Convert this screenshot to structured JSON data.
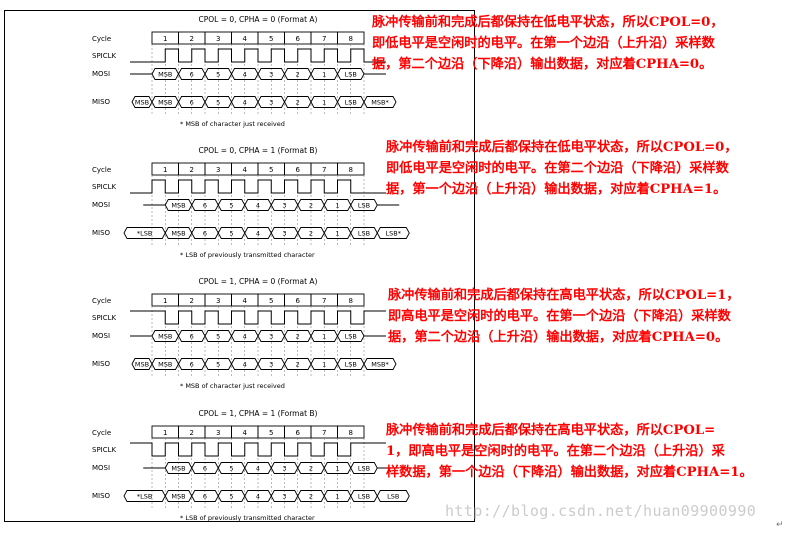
{
  "sections": [
    {
      "title": "CPOL = 0, CPHA = 0 (Format A)",
      "cpol": 0,
      "cpha": 0,
      "labels": {
        "cycle": "Cycle",
        "sclk": "SPICLK",
        "mosi": "MOSI",
        "miso": "MISO"
      },
      "cycles": [
        "1",
        "2",
        "3",
        "4",
        "5",
        "6",
        "7",
        "8"
      ],
      "mosi": [
        "MSB",
        "6",
        "5",
        "4",
        "3",
        "2",
        "1",
        "LSB"
      ],
      "miso_pre": "MSB",
      "miso": [
        "MSB",
        "6",
        "5",
        "4",
        "3",
        "2",
        "1",
        "LSB"
      ],
      "miso_post": "MSB*",
      "footnote": "* MSB of character just received",
      "note_lines": [
        "脉冲传输前和完成后都保持在低电平状态，所以CPOL=0，",
        "即低电平是空闲时的电平。在第一个边沿（上升沿）采样数",
        "据，第二个边沿（下降沿）输出数据，对应着CPHA=0。"
      ]
    },
    {
      "title": "CPOL = 0, CPHA = 1 (Format B)",
      "cpol": 0,
      "cpha": 1,
      "labels": {
        "cycle": "Cycle",
        "sclk": "SPICLK",
        "mosi": "MOSI",
        "miso": "MISO"
      },
      "cycles": [
        "1",
        "2",
        "3",
        "4",
        "5",
        "6",
        "7",
        "8"
      ],
      "mosi": [
        "MSB",
        "6",
        "5",
        "4",
        "3",
        "2",
        "1",
        "LSB"
      ],
      "miso_pre": "*LSB",
      "miso": [
        "MSB",
        "6",
        "5",
        "4",
        "3",
        "2",
        "1",
        "LSB"
      ],
      "miso_post": "LSB*",
      "footnote": "* LSB of previously transmitted character",
      "note_lines": [
        "脉冲传输前和完成后都保持在低电平状态，所以CPOL=0，",
        "即低电平是空闲时的电平。在第二个边沿（下降沿）采样数",
        "据，第一个边沿（上升沿）输出数据，对应着CPHA=1。"
      ]
    },
    {
      "title": "CPOL = 1, CPHA = 0 (Format A)",
      "cpol": 1,
      "cpha": 0,
      "labels": {
        "cycle": "Cycle",
        "sclk": "SPICLK",
        "mosi": "MOSI",
        "miso": "MISO"
      },
      "cycles": [
        "1",
        "2",
        "3",
        "4",
        "5",
        "6",
        "7",
        "8"
      ],
      "mosi": [
        "MSB",
        "6",
        "5",
        "4",
        "3",
        "2",
        "1",
        "LSB"
      ],
      "miso_pre": "MSB",
      "miso": [
        "MSB",
        "6",
        "5",
        "4",
        "3",
        "2",
        "1",
        "LSB"
      ],
      "miso_post": "MSB*",
      "footnote": "* MSB of character just received",
      "note_lines": [
        "脉冲传输前和完成后都保持在高电平状态，所以CPOL=1，",
        "即高电平是空闲时的电平。在第一个边沿（下降沿）采样数",
        "据，第二个边沿（上升沿）输出数据，对应着CPHA=0。"
      ]
    },
    {
      "title": "CPOL = 1, CPHA = 1 (Format B)",
      "cpol": 1,
      "cpha": 1,
      "labels": {
        "cycle": "Cycle",
        "sclk": "SPICLK",
        "mosi": "MOSI",
        "miso": "MISO"
      },
      "cycles": [
        "1",
        "2",
        "3",
        "4",
        "5",
        "6",
        "7",
        "8"
      ],
      "mosi": [
        "MSB",
        "6",
        "5",
        "4",
        "3",
        "2",
        "1",
        "LSB"
      ],
      "miso_pre": "*LSB",
      "miso": [
        "MSB",
        "6",
        "5",
        "4",
        "3",
        "2",
        "1",
        "LSB"
      ],
      "miso_post": "LSB",
      "footnote": "* LSB of previously transmitted character",
      "note_lines": [
        "脉冲传输前和完成后都保持在高电平状态，所以CPOL=",
        "1，即高电平是空闲时的电平。在第二个边沿（上升沿）采",
        "样数据，第一个边沿（下降沿）输出数据，对应着CPHA=1。"
      ]
    }
  ],
  "watermark": "http://blog.csdn.net/huan09900990",
  "corner_mark": "↵"
}
